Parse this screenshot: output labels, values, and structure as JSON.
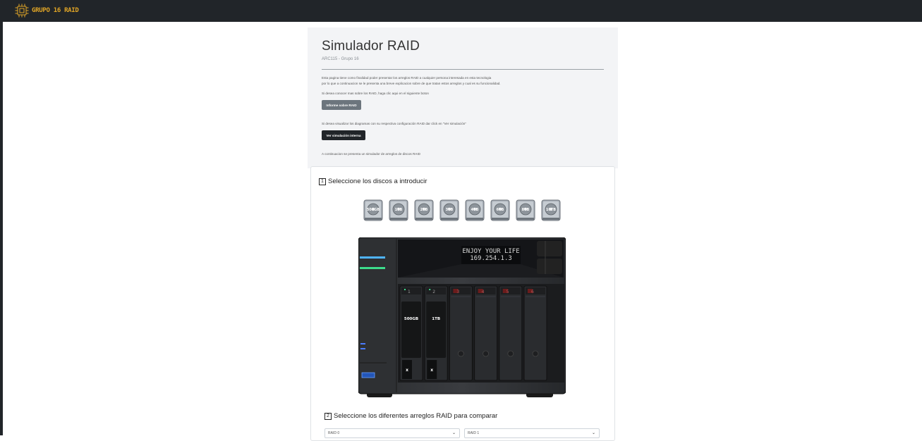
{
  "navbar": {
    "brand_text": "GRUPO 16 RAID",
    "logo_icon": "cpu-chip-icon",
    "accent_color": "#e0a526",
    "background_color": "#212529"
  },
  "header": {
    "title": "Simulador RAID",
    "subtitle": "ARC115 - Grupo 16",
    "intro_line1": "Esta pagina tiene como finalidad poder presentar los arreglos RAID a cualquier persona interesada en esta tecnologia",
    "intro_line2": "por lo que a continuacion se le presenta una breve explicacion sobre de que tratan estos arreglos y cual es su funcionalidad.",
    "info_text": "Si desea conocer mas sobre los RAID, haga clic aqui en el siguiente boton",
    "info_button_label": "Informe sobre RAID",
    "diagram_text": "Si desea visualizar los diagramas con su respectiva configuración RAID dar click en \"Ver simulación\"",
    "sim_button_label": "Ver simulación interna",
    "simulator_text": "A continuacion se presenta un simulador de arreglos de discos RAID"
  },
  "step1": {
    "number": "1",
    "label": "Seleccione los discos a introducir",
    "disks": [
      "500GB",
      "1TB",
      "2TB",
      "3TB",
      "4TB",
      "6TB",
      "8TB",
      "10TB"
    ]
  },
  "nas": {
    "lcd_line1": "ENJOY YOUR LIFE",
    "lcd_line2": "169.254.1.3",
    "bays": [
      {
        "bay": "1",
        "disk": "500GB",
        "remove_label": "x"
      },
      {
        "bay": "2",
        "disk": "1TB",
        "remove_label": "x"
      },
      {
        "bay": "3",
        "disk": ""
      },
      {
        "bay": "4",
        "disk": ""
      },
      {
        "bay": "5",
        "disk": ""
      },
      {
        "bay": "6",
        "disk": ""
      }
    ]
  },
  "step2": {
    "number": "2",
    "label": "Seleccione los diferentes arreglos RAID para comparar",
    "select_left_value": "RAID 0",
    "select_right_value": "RAID 1"
  }
}
